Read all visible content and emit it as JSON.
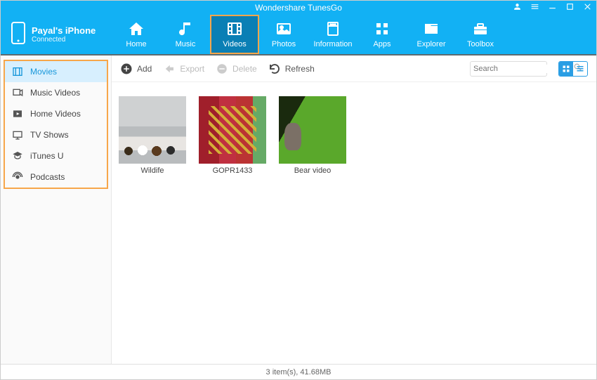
{
  "app": {
    "title": "Wondershare TunesGo"
  },
  "device": {
    "name": "Payal's iPhone",
    "status": "Connected"
  },
  "nav": {
    "items": [
      {
        "label": "Home"
      },
      {
        "label": "Music"
      },
      {
        "label": "Videos"
      },
      {
        "label": "Photos"
      },
      {
        "label": "Information"
      },
      {
        "label": "Apps"
      },
      {
        "label": "Explorer"
      },
      {
        "label": "Toolbox"
      }
    ],
    "activeIndex": 2
  },
  "sidebar": {
    "items": [
      {
        "label": "Movies"
      },
      {
        "label": "Music Videos"
      },
      {
        "label": "Home Videos"
      },
      {
        "label": "TV Shows"
      },
      {
        "label": "iTunes U"
      },
      {
        "label": "Podcasts"
      }
    ],
    "activeIndex": 0
  },
  "toolbar": {
    "add": "Add",
    "export": "Export",
    "delete": "Delete",
    "refresh": "Refresh"
  },
  "search": {
    "placeholder": "Search"
  },
  "videos": [
    {
      "title": "Wildife"
    },
    {
      "title": "GOPR1433"
    },
    {
      "title": "Bear video"
    }
  ],
  "status": {
    "text": "3 item(s), 41.68MB"
  }
}
